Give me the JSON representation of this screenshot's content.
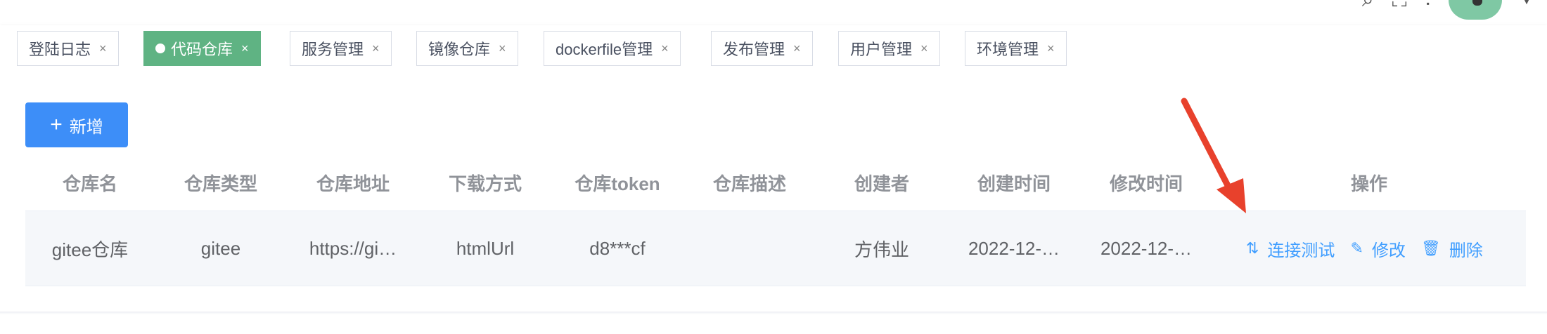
{
  "tags": [
    {
      "label": "登陆日志",
      "active": false
    },
    {
      "label": "代码仓库",
      "active": true
    },
    {
      "label": "服务管理",
      "active": false
    },
    {
      "label": "镜像仓库",
      "active": false
    },
    {
      "label": "dockerfile管理",
      "active": false
    },
    {
      "label": "发布管理",
      "active": false
    },
    {
      "label": "用户管理",
      "active": false
    },
    {
      "label": "环境管理",
      "active": false
    }
  ],
  "tag_close": "×",
  "toolbar": {
    "add_label": "新增",
    "add_icon": "plus-icon"
  },
  "table": {
    "columns": [
      "仓库名",
      "仓库类型",
      "仓库地址",
      "下载方式",
      "仓库token",
      "仓库描述",
      "创建者",
      "创建时间",
      "修改时间",
      "操作"
    ],
    "rows": [
      {
        "name": "gitee仓库",
        "type": "gitee",
        "url": "https://gi…",
        "download": "htmlUrl",
        "token": "d8***cf",
        "desc": "",
        "creator": "方伟业",
        "created": "2022-12-…",
        "modified": "2022-12-…"
      }
    ],
    "actions": {
      "test_label": "连接测试",
      "edit_label": "修改",
      "delete_label": "删除"
    }
  },
  "colors": {
    "primary": "#3d8ef8",
    "active_tag": "#5fb383",
    "link": "#409eff",
    "arrow": "#e8412c"
  }
}
